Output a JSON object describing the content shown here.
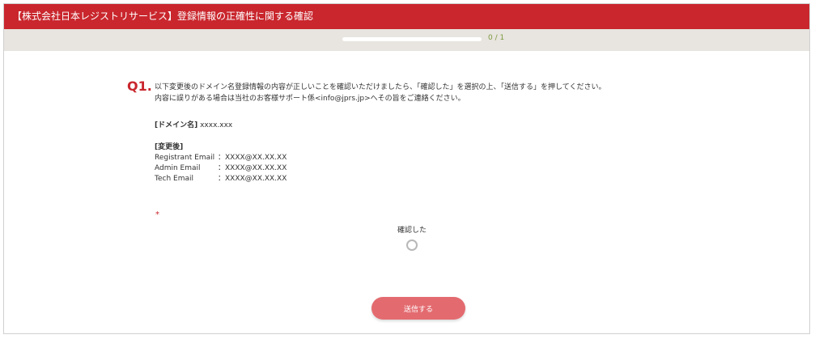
{
  "header": {
    "title": "【株式会社日本レジストリサービス】登録情報の正確性に関する確認"
  },
  "progress": {
    "text": "0 / 1",
    "fraction": 0.0
  },
  "question": {
    "number": "Q1.",
    "line1": "以下変更後のドメイン名登録情報の内容が正しいことを確認いただけましたら、「確認した」を選択の上、「送信する」を押してください。",
    "line2": "内容に誤りがある場合は当社のお客様サポート係<info@jprs.jp>へその旨をご連絡ください。",
    "domain_label": "[ドメイン名]",
    "domain_value": " xxxx.xxx",
    "after_label": "[変更後]",
    "emails": [
      {
        "label": "Registrant Email",
        "value": "：XXXX@XX.XX.XX"
      },
      {
        "label": "Admin Email",
        "value": "：XXXX@XX.XX.XX"
      },
      {
        "label": "Tech Email",
        "value": "：XXXX@XX.XX.XX"
      }
    ],
    "required_mark": "*",
    "option_label": "確認した"
  },
  "submit": {
    "label": "送信する"
  },
  "colors": {
    "brand": "#c9262d",
    "button": "#e36b70",
    "progress_text": "#7a9a3e"
  }
}
